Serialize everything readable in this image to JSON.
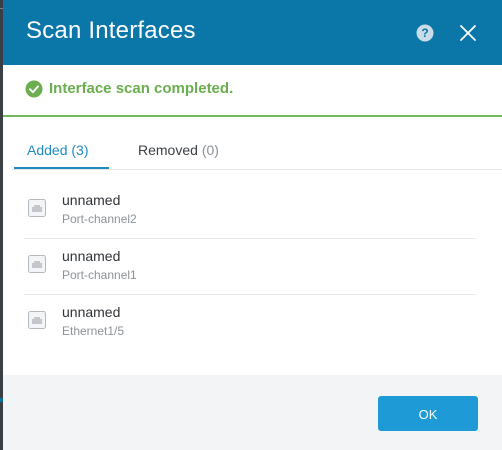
{
  "dialog": {
    "title": "Scan Interfaces",
    "help_icon": "question-circle-icon",
    "close_icon": "close-icon"
  },
  "status": {
    "icon": "check-circle-icon",
    "message": "Interface scan completed.",
    "color": "#6aae4f"
  },
  "tabs": [
    {
      "label": "Added",
      "count": "(3)",
      "active": true
    },
    {
      "label": "Removed",
      "count": "(0)",
      "active": false
    }
  ],
  "interfaces": [
    {
      "name": "unnamed",
      "port": "Port-channel2",
      "icon": "interface-port-icon"
    },
    {
      "name": "unnamed",
      "port": "Port-channel1",
      "icon": "interface-port-icon"
    },
    {
      "name": "unnamed",
      "port": "Ethernet1/5",
      "icon": "interface-port-icon"
    }
  ],
  "footer": {
    "ok_label": "OK"
  },
  "colors": {
    "header": "#0b76a8",
    "accent": "#1e8bc3",
    "ok_button": "#1e9ad6"
  }
}
